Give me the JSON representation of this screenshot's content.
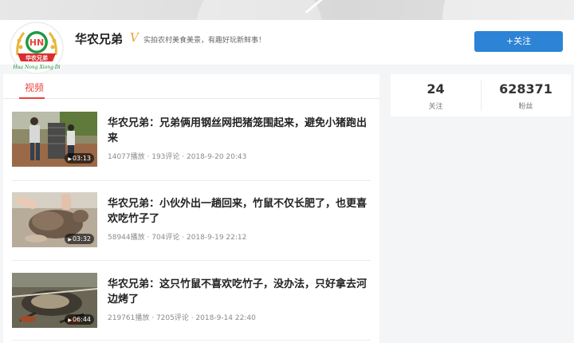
{
  "header": {
    "channel_name": "华农兄弟",
    "verified_mark": "V",
    "tagline": "实拍农村美食美景，有趣好玩新鲜事！",
    "follow_label": "+关注",
    "logo": {
      "letters": "HN",
      "banner_text": "华农兄弟",
      "caption": "Hua Nong Xiong Di"
    }
  },
  "tabs": [
    {
      "label": "视频",
      "active": true
    }
  ],
  "stats": [
    {
      "value": "24",
      "label": "关注"
    },
    {
      "value": "628371",
      "label": "粉丝"
    }
  ],
  "videos": [
    {
      "title": "华农兄弟：兄弟俩用钢丝网把猪笼围起来，避免小猪跑出来",
      "duration": "03:13",
      "meta": "14077播放 · 193评论 · 2018-9-20 20:43"
    },
    {
      "title": "华农兄弟：小伙外出一趟回来，竹鼠不仅长肥了，也更喜欢吃竹子了",
      "duration": "03:32",
      "meta": "58944播放 · 704评论 · 2018-9-19 22:12"
    },
    {
      "title": "华农兄弟：这只竹鼠不喜欢吃竹子，没办法，只好拿去河边烤了",
      "duration": "06:44",
      "meta": "219761播放 · 7205评论 · 2018-9-14 22:40"
    }
  ],
  "colors": {
    "accent_red": "#e8453c",
    "follow_blue": "#2d83d6",
    "logo_green": "#1a8a3a",
    "logo_gold": "#e8b73a"
  },
  "icons": [
    "play-icon",
    "verified-icon",
    "logo-emblem"
  ]
}
